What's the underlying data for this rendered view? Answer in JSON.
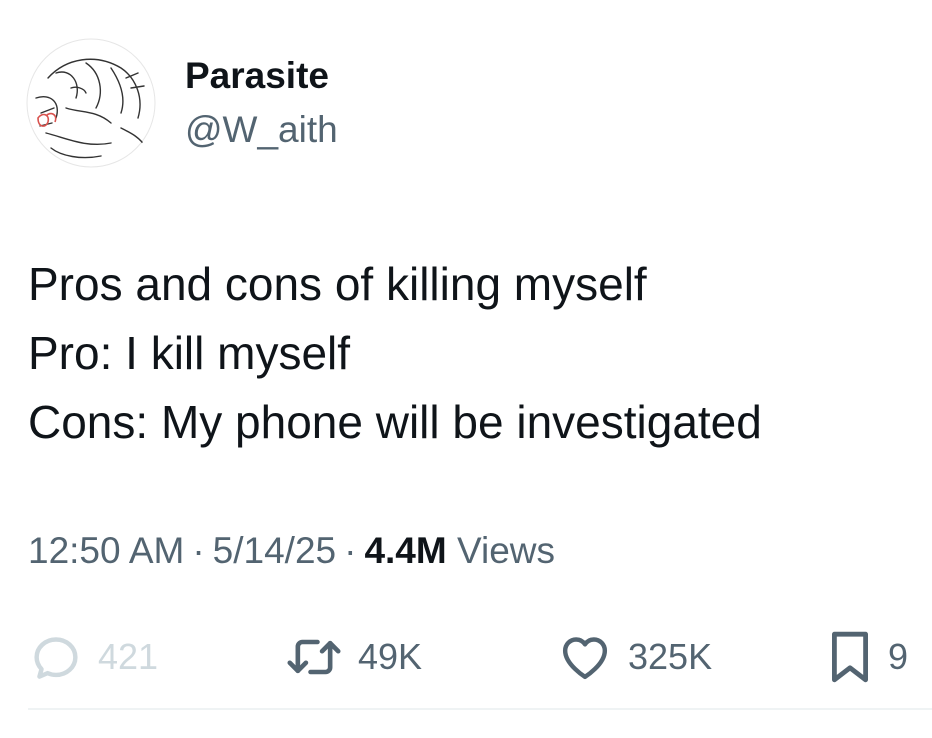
{
  "author": {
    "display_name": "Parasite",
    "handle": "@W_aith"
  },
  "tweet": {
    "lines": [
      "Pros and cons of killing myself",
      "Pro: I kill myself",
      "Cons: My phone will be investigated"
    ]
  },
  "meta": {
    "time": "12:50 AM",
    "separator": "·",
    "date": "5/14/25",
    "views_count": "4.4M",
    "views_label": "Views"
  },
  "actions": {
    "replies": "421",
    "reposts": "49K",
    "likes": "325K",
    "bookmarks": "9"
  },
  "colors": {
    "primary_text": "#0f1419",
    "secondary_text": "#536471",
    "faded_icon": "#cfd9de",
    "divider": "#eff3f4"
  }
}
